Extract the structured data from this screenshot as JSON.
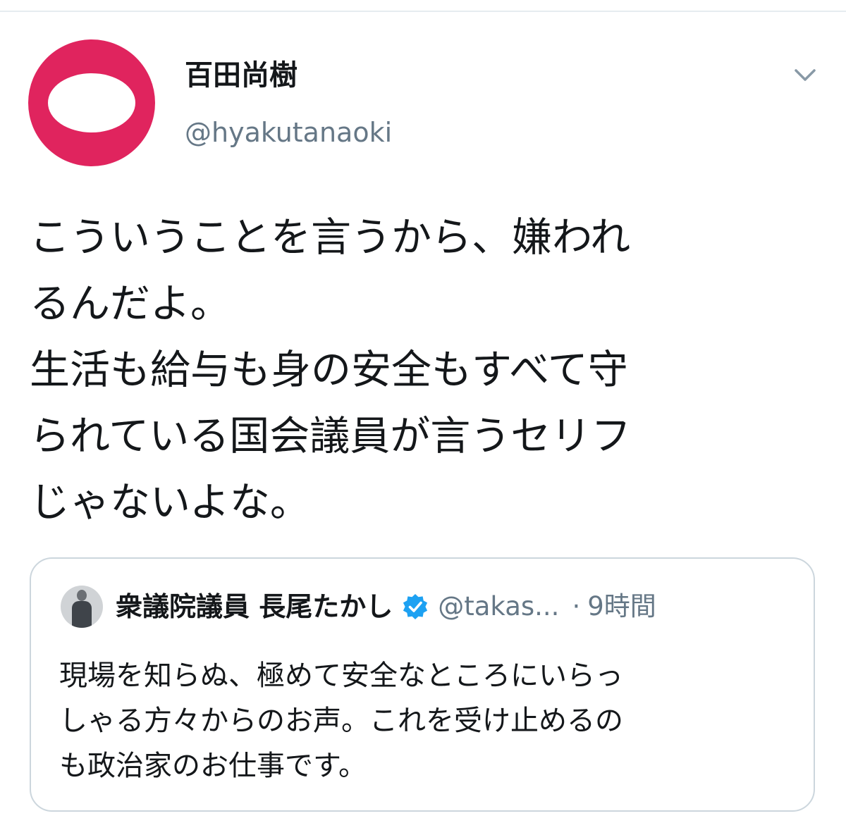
{
  "tweet": {
    "display_name": "百田尚樹",
    "handle": "@hyakutanaoki",
    "avatar_icon": "red-egg-avatar",
    "menu_icon": "chevron-down-icon",
    "text": "こういうことを言うから、嫌われ\nるんだよ。\n生活も給与も身の安全もすべて守\nられている国会議員が言うセリフ\nじゃないよな。"
  },
  "quoted": {
    "display_name": "衆議院議員 長尾たかし",
    "verified_icon": "verified-badge-icon",
    "handle": "@takas...",
    "separator": "·",
    "time": "9時間",
    "text": "現場を知らぬ、極めて安全なところにいらっ\nしゃる方々からのお声。これを受け止めるの\nも政治家のお仕事です。"
  },
  "colors": {
    "avatar_red": "#e0245e",
    "verified_blue": "#1da1f2",
    "secondary_text": "#657786",
    "border": "#ccd6dd"
  }
}
